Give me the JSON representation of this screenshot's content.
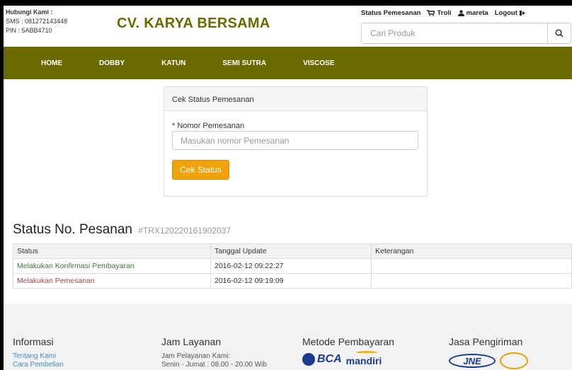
{
  "contact": {
    "title": "Hubungi Kami :",
    "sms": "SMS : 081272143448",
    "pin": "PIN : 5ABB4710"
  },
  "brand": "CV. KARYA BERSAMA",
  "toplinks": {
    "status": "Status Pemesanan",
    "cart": "Troli",
    "user": "mareta",
    "logout": "Logout"
  },
  "search": {
    "placeholder": "Cari Produk"
  },
  "nav": [
    "HOME",
    "DOBBY",
    "KATUN",
    "SEMI SUTRA",
    "VISCOSE"
  ],
  "panel": {
    "heading": "Cek Status Pemesanan",
    "field_label": "* Nomor Pemesanan",
    "field_placeholder": "Masukan nomor Pemesanan",
    "button": "Cek Status"
  },
  "status": {
    "title": "Status No. Pesanan",
    "order_no": "#TRX120220161902037",
    "columns": [
      "Status",
      "Tanggal Update",
      "Keterangan"
    ],
    "rows": [
      {
        "status": "Melakukan Konfirmasi Pembayaran",
        "date": "2016-02-12 09:22:27",
        "note": ""
      },
      {
        "status": "Melakukan Pemesanan",
        "date": "2016-02-12 09:19:09",
        "note": ""
      }
    ]
  },
  "footer": {
    "info": {
      "title": "Informasi",
      "links": [
        "Tentang Kami",
        "Cara Pembelian"
      ]
    },
    "hours": {
      "title": "Jam Layanan",
      "lines": [
        "Jam Pelayanan Kami:",
        "Senin - Jumat : 08.00 - 20.00 Wib"
      ]
    },
    "payment": {
      "title": "Metode Pembayaran",
      "logos": [
        "BCA",
        "mandiri"
      ]
    },
    "shipping": {
      "title": "Jasa Pengiriman",
      "logos": [
        "JNE"
      ]
    }
  },
  "colors": {
    "brand": "#6b6a00",
    "accent": "#f0a30a",
    "link": "#428bca"
  }
}
